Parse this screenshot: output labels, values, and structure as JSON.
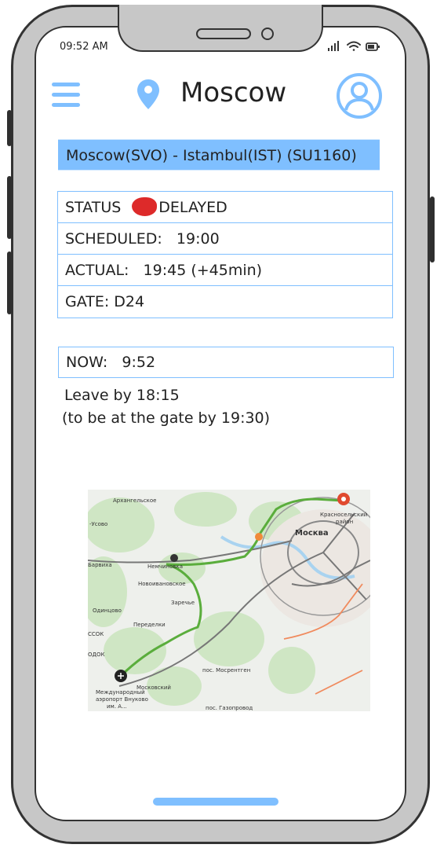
{
  "status_bar": {
    "time": "09:52 AM"
  },
  "header": {
    "city": "Moscow"
  },
  "flight": {
    "title": "Moscow(SVO) - Istambul(IST)  (SU1160)"
  },
  "details": {
    "status_label": "STATUS",
    "status_value": "DELAYED",
    "scheduled": "SCHEDULED:   19:00",
    "actual": "ACTUAL:   19:45 (+45min)",
    "gate": "GATE: D24"
  },
  "now": {
    "text": "NOW:   9:52"
  },
  "leave": {
    "line1": "Leave by 18:15",
    "line2": "(to be at the gate by 19:30)"
  },
  "map": {
    "labels": {
      "arkhangelskoe": "Архангельское",
      "usovo": "-Усово",
      "krasnoselsky": "Красносельский",
      "rayon": "район",
      "moskva": "Москва",
      "barvikha": "Барвиха",
      "nemchinovka": "Немчиновка",
      "novoivanovskoe": "Новоивановское",
      "zarechye": "Заречье",
      "odintsovo": "Одинцово",
      "peredelki": "Переделки",
      "sesok": "ССОК",
      "odok": "ОДОК",
      "mosrentgen": "пос. Мосрентген",
      "moskovsky": "Московский",
      "airport1": "Международный",
      "airport2": "аэропорт Внуково",
      "airport3": "им. А...",
      "gazoprovod": "пос. Газопровод"
    }
  },
  "colors": {
    "accent": "#7fbfff",
    "status_delayed": "#dd2a2a",
    "route": "#5aad3c"
  }
}
